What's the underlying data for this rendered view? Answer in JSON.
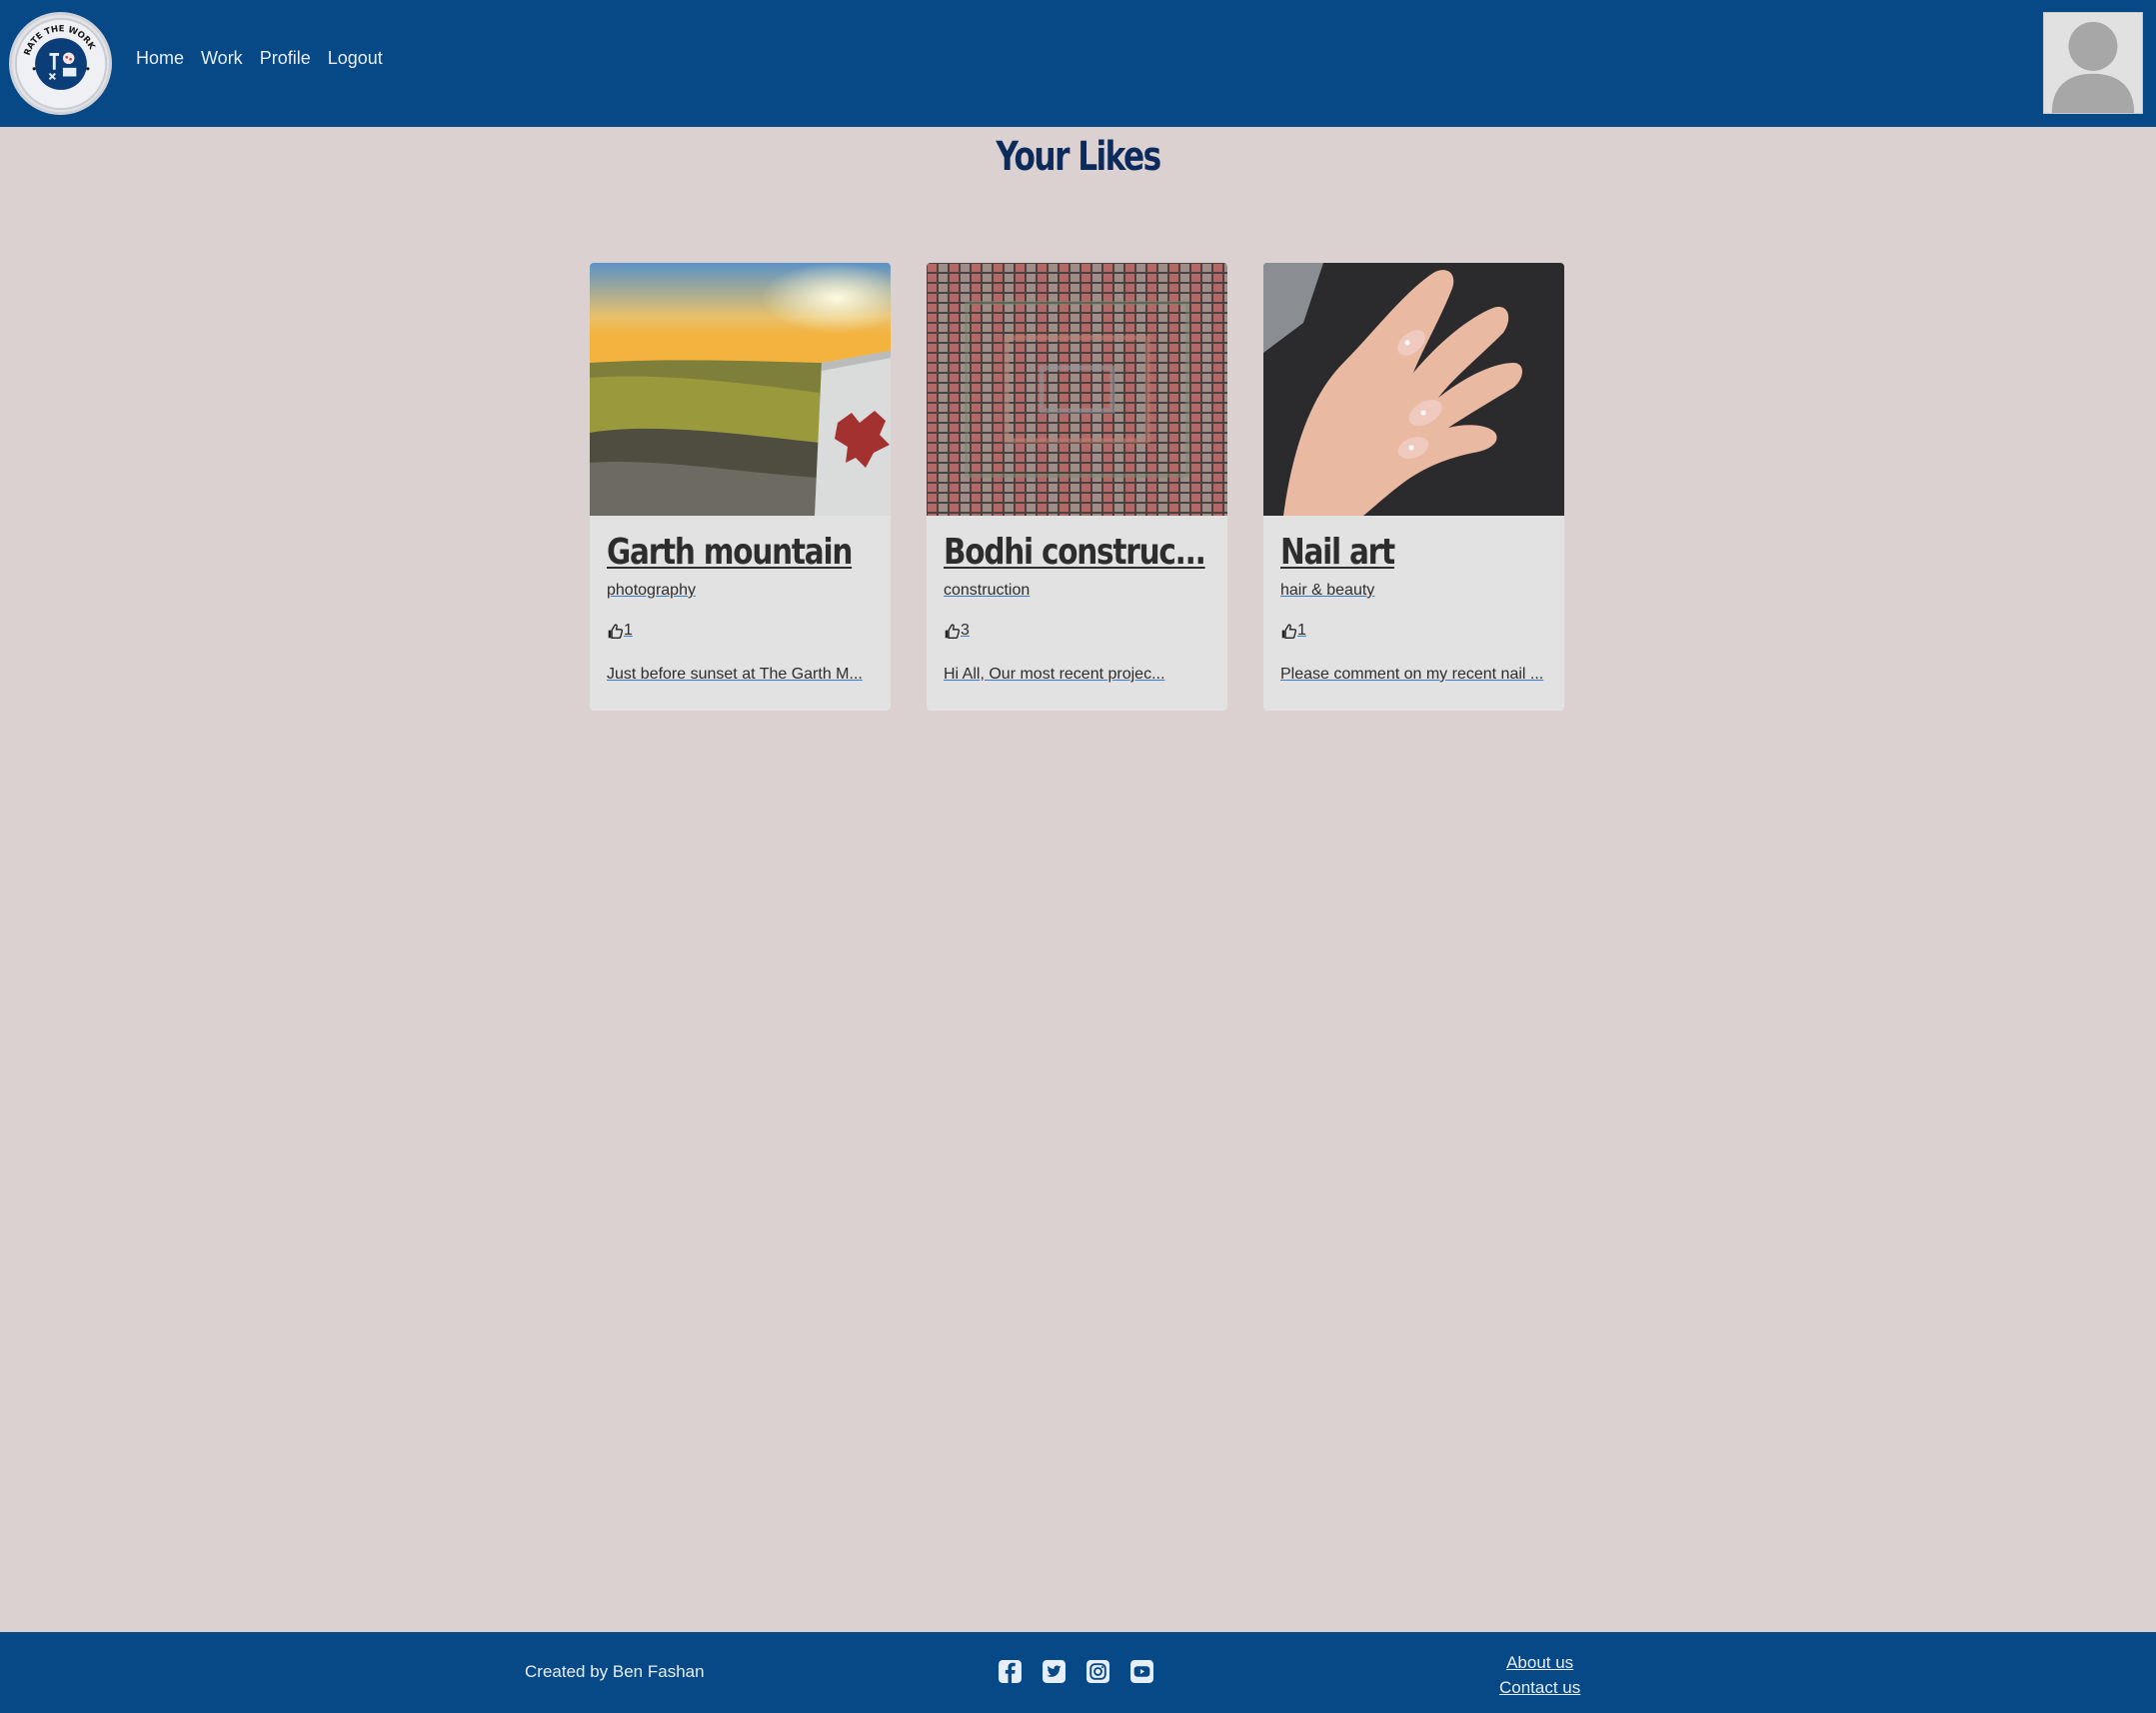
{
  "nav": {
    "logo_alt": "Rate The Work",
    "links": [
      "Home",
      "Work",
      "Profile",
      "Logout"
    ]
  },
  "page": {
    "title": "Your Likes"
  },
  "cards": [
    {
      "title": "Garth mountain",
      "category": "photography",
      "likes": "1",
      "excerpt": "Just before sunset at The Garth M..."
    },
    {
      "title": "Bodhi construc...",
      "category": "construction",
      "likes": "3",
      "excerpt": "Hi All, Our most recent projec..."
    },
    {
      "title": "Nail art",
      "category": "hair & beauty",
      "likes": "1",
      "excerpt": "Please comment on my recent nail ..."
    }
  ],
  "footer": {
    "credit": "Created by Ben Fashan",
    "socials": [
      "facebook-icon",
      "twitter-icon",
      "instagram-icon",
      "youtube-icon"
    ],
    "links": [
      "About us",
      "Contact us"
    ]
  },
  "colors": {
    "header_bg": "#074886",
    "page_bg": "#dbd1d1",
    "card_bg": "#e2e2e2",
    "title": "#0d2a5c"
  }
}
